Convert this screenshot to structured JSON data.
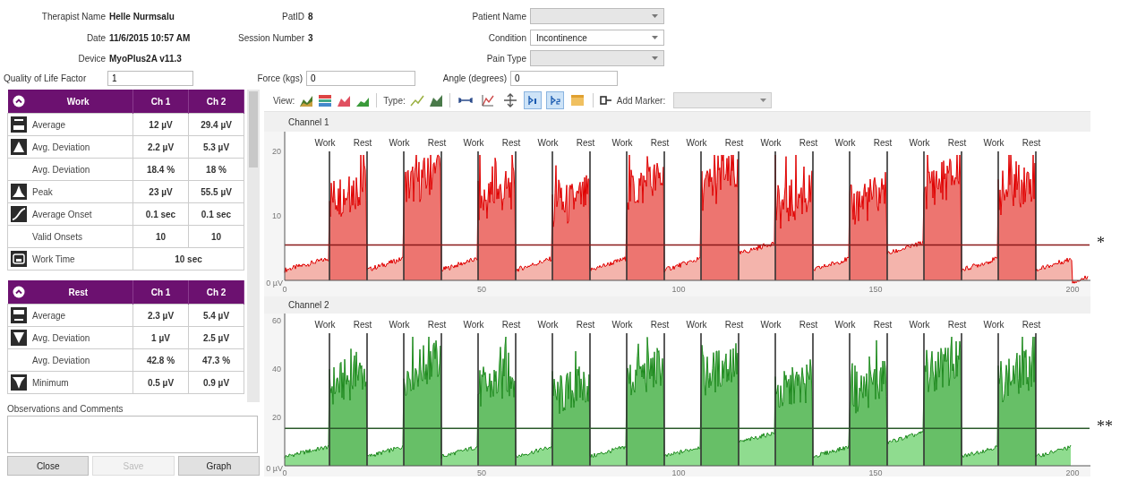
{
  "header": {
    "therapist_name": {
      "label": "Therapist Name",
      "value": "Helle Nurmsalu"
    },
    "pat_id": {
      "label": "PatID",
      "value": "8"
    },
    "patient_name": {
      "label": "Patient Name",
      "disabled": true
    },
    "date": {
      "label": "Date",
      "value": "11/6/2015 10:57 AM"
    },
    "session_number": {
      "label": "Session Number",
      "value": "3"
    },
    "condition": {
      "label": "Condition",
      "value": "Incontinence",
      "disabled": false
    },
    "device": {
      "label": "Device",
      "value": "MyoPlus2A v11.3"
    },
    "pain_type": {
      "label": "Pain Type",
      "disabled": true
    },
    "quality_of_life_factor": {
      "label": "Quality of Life Factor",
      "value": "1"
    },
    "force": {
      "label": "Force (kgs)",
      "value": "0"
    },
    "angle": {
      "label": "Angle (degrees)",
      "value": "0"
    }
  },
  "work_table": {
    "columns": [
      "Work",
      "Ch 1",
      "Ch 2"
    ],
    "rows": [
      {
        "label": "Average",
        "ch1": "12 µV",
        "ch2": "29.4 µV"
      },
      {
        "label": "Avg. Deviation",
        "ch1": "2.2 µV",
        "ch2": "5.3 µV"
      },
      {
        "label": "Avg. Deviation",
        "ch1": "18.4 %",
        "ch2": "18 %"
      },
      {
        "label": "Peak",
        "ch1": "23 µV",
        "ch2": "55.5 µV"
      },
      {
        "label": "Average Onset",
        "ch1": "0.1 sec",
        "ch2": "0.1 sec"
      },
      {
        "label": "Valid Onsets",
        "ch1": "10",
        "ch2": "10"
      },
      {
        "label": "Work Time",
        "value": "10 sec"
      }
    ]
  },
  "rest_table": {
    "columns": [
      "Rest",
      "Ch 1",
      "Ch 2"
    ],
    "rows": [
      {
        "label": "Average",
        "ch1": "2.3 µV",
        "ch2": "5.4 µV"
      },
      {
        "label": "Avg. Deviation",
        "ch1": "1 µV",
        "ch2": "2.5 µV"
      },
      {
        "label": "Avg. Deviation",
        "ch1": "42.8 %",
        "ch2": "47.3 %"
      },
      {
        "label": "Minimum",
        "ch1": "0.5 µV",
        "ch2": "0.9 µV"
      }
    ]
  },
  "observations": {
    "label": "Observations and Comments"
  },
  "buttons": [
    {
      "label": "Close",
      "disabled": false
    },
    {
      "label": "Save",
      "disabled": true
    },
    {
      "label": "Graph",
      "disabled": false
    }
  ],
  "toolbar": {
    "view_label": "View:",
    "type_label": "Type:",
    "tools": [
      {
        "selected": false
      },
      {
        "selected": false
      },
      {
        "selected": false
      },
      {
        "selected": true
      },
      {
        "selected": true
      },
      {
        "selected": false
      }
    ],
    "add_marker_label": "Add Marker:"
  },
  "charts": [
    {
      "title": "Channel 1",
      "color": "#e00000",
      "y_ticks": [
        "20",
        "10",
        "0 µV"
      ],
      "x_ticks": [
        "0",
        "50",
        "100",
        "150",
        "200"
      ],
      "markers": [
        "Work",
        "Rest",
        "Work",
        "Rest",
        "Work",
        "Rest",
        "Work",
        "Rest",
        "Work",
        "Rest",
        "Work",
        "Rest",
        "Work",
        "Rest",
        "Work",
        "Rest",
        "Work",
        "Rest",
        "Work",
        "Rest"
      ],
      "note": "*"
    },
    {
      "title": "Channel 2",
      "color": "#1e8a1e",
      "y_ticks": [
        "60",
        "40",
        "20",
        "0 µV"
      ],
      "x_ticks": [
        "0",
        "50",
        "100",
        "150",
        "200"
      ],
      "markers": [
        "Work",
        "Rest",
        "Work",
        "Rest",
        "Work",
        "Rest",
        "Work",
        "Rest",
        "Work",
        "Rest",
        "Work",
        "Rest",
        "Work",
        "Rest",
        "Work",
        "Rest",
        "Work",
        "Rest",
        "Work",
        "Rest"
      ],
      "note": "**"
    }
  ]
}
